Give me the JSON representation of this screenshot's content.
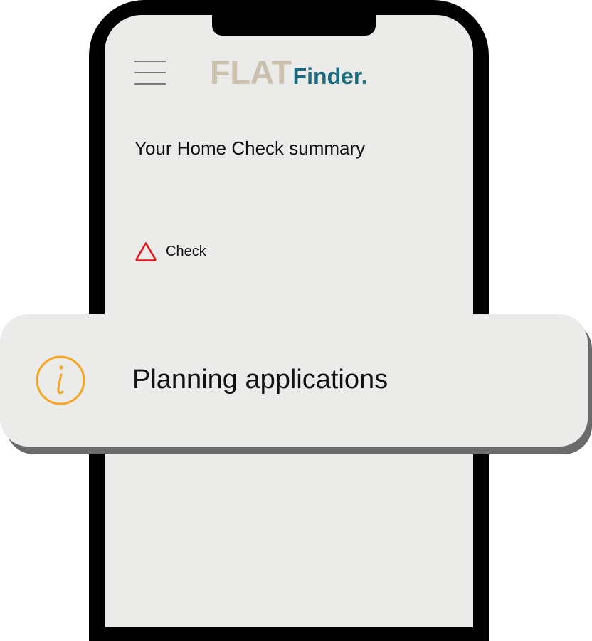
{
  "header": {
    "logo_primary": "FLAT",
    "logo_secondary": "Finder."
  },
  "summary": {
    "title": "Your Home Check summary"
  },
  "check": {
    "label": "Check",
    "icon": "warning-triangle-icon"
  },
  "card": {
    "title": "Planning applications",
    "icon": "info-icon"
  },
  "colors": {
    "logo_primary": "#cbbfae",
    "logo_secondary": "#1b6a7d",
    "warning": "#e8141c",
    "info": "#f5a623",
    "screen_bg": "#ebebe9"
  }
}
